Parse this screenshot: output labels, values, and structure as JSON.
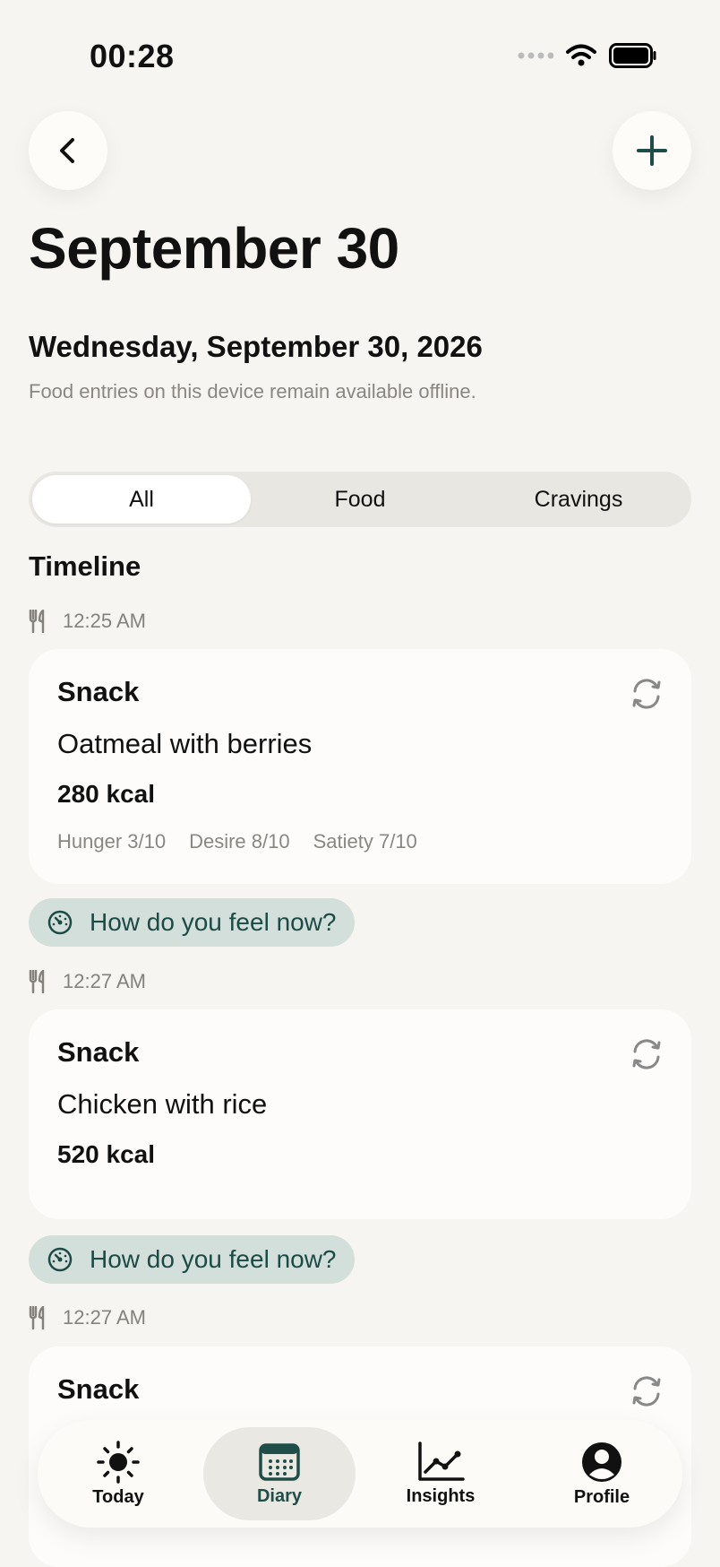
{
  "status_bar": {
    "time": "00:28"
  },
  "header": {
    "title": "September 30"
  },
  "date_info": {
    "full_date": "Wednesday, September 30, 2026",
    "offline_note": "Food entries on this device remain available offline."
  },
  "filter_tabs": {
    "selected": "All",
    "items": [
      "All",
      "Food",
      "Cravings"
    ]
  },
  "timeline": {
    "title": "Timeline",
    "entries": [
      {
        "time": "12:25 AM",
        "type": "Snack",
        "name": "Oatmeal with berries",
        "kcal": "280 kcal",
        "metrics": [
          "Hunger 3/10",
          "Desire 8/10",
          "Satiety 7/10"
        ],
        "feel_prompt": "How do you feel now?"
      },
      {
        "time": "12:27 AM",
        "type": "Snack",
        "name": "Chicken with rice",
        "kcal": "520 kcal",
        "feel_prompt": "How do you feel now?"
      },
      {
        "time": "12:27 AM",
        "type": "Snack"
      }
    ]
  },
  "bottom_nav": {
    "items": [
      {
        "label": "Today",
        "icon": "sun-icon"
      },
      {
        "label": "Diary",
        "icon": "calendar-icon",
        "active": true
      },
      {
        "label": "Insights",
        "icon": "chart-icon"
      },
      {
        "label": "Profile",
        "icon": "profile-icon"
      }
    ]
  },
  "colors": {
    "accent": "#1f4d48",
    "pill_bg": "#d3dfda",
    "background": "#f7f5f1"
  }
}
